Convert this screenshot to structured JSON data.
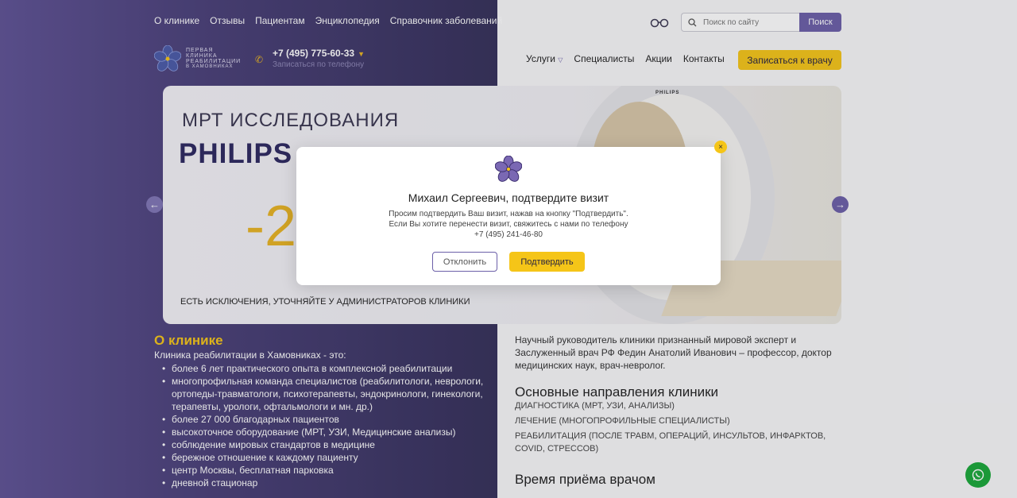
{
  "top_nav": [
    "О клинике",
    "Отзывы",
    "Пациентам",
    "Энциклопедия",
    "Справочник заболеваний"
  ],
  "search": {
    "placeholder": "Поиск по сайту",
    "button": "Поиск"
  },
  "logo": {
    "line1": "ПЕРВАЯ",
    "line2": "КЛИНИКА",
    "line3": "РЕАБИЛИТАЦИИ",
    "line4": "В ХАМОВНИКАХ"
  },
  "phone": {
    "number": "+7 (495) 775-60-33",
    "sub": "Записаться по телефону"
  },
  "main_nav": {
    "services": "Услуги",
    "specialists": "Специалисты",
    "promotions": "Акции",
    "contacts": "Контакты"
  },
  "cta": "Записаться к врачу",
  "hero": {
    "title1": "МРТ  ИССЛЕДОВАНИЯ",
    "title2": "PHILIPS",
    "discount": "-2",
    "brand": "PHILIPS",
    "note": "ЕСТЬ ИСКЛЮЧЕНИЯ, УТОЧНЯЙТЕ У АДМИНИСТРАТОРОВ КЛИНИКИ"
  },
  "about": {
    "heading": "О клинике",
    "intro": "Клиника реабилитации в Хамовниках - это:",
    "items": [
      "более 6 лет практического опыта в комплексной реабилитации",
      "многопрофильная команда специалистов (реабилитологи, неврологи, ортопеды-травматологи, психотерапевты, эндокринологи, гинекологи, терапевты, урологи, офтальмологи и мн. др.)",
      "более 27 000 благодарных пациентов",
      "высокоточное оборудование (МРТ, УЗИ, Медицинские анализы)",
      "соблюдение мировых стандартов в медицине",
      "бережное отношение к каждому пациенту",
      "центр Москвы, бесплатная парковка",
      "дневной стационар"
    ]
  },
  "right": {
    "paragraph": "Научный руководитель клиники признанный мировой эксперт и Заслуженный врач РФ Федин Анатолий Иванович – профессор, доктор медицинских наук, врач-невролог.",
    "directions_heading": "Основные направления клиники",
    "directions": [
      "ДИАГНОСТИКА (МРТ, УЗИ, АНАЛИЗЫ)",
      "ЛЕЧЕНИЕ (МНОГОПРОФИЛЬНЫЕ СПЕЦИАЛИСТЫ)",
      "РЕАБИЛИТАЦИЯ (ПОСЛЕ ТРАВМ, ОПЕРАЦИЙ, ИНСУЛЬТОВ, ИНФАРКТОВ, COVID, СТРЕССОВ)"
    ],
    "time_heading": "Время приёма врачом"
  },
  "modal": {
    "close": "×",
    "title": "Михаил Сергеевич, подтвердите визит",
    "line1": "Просим подтвердить Ваш визит, нажав на кнопку \"Подтвердить\".",
    "line2": "Если Вы хотите перенести визит, свяжитесь с нами по телефону",
    "phone": "+7 (495) 241-46-80",
    "decline": "Отклонить",
    "confirm": "Подтвердить"
  },
  "colors": {
    "brand_purple": "#6b5fa8",
    "accent_yellow": "#f5c518",
    "whatsapp_green": "#1aa83a"
  }
}
